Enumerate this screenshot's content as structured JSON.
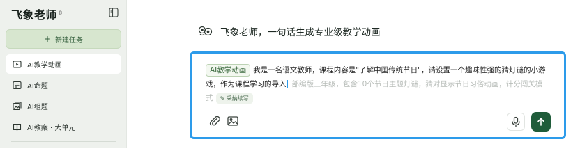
{
  "brand": {
    "name": "飞象老师",
    "mark": "®"
  },
  "sidebar": {
    "new_task_label": "新建任务",
    "items": [
      {
        "label": "AI教学动画",
        "icon": "animation-icon",
        "active": true
      },
      {
        "label": "AI命题",
        "icon": "list-icon",
        "active": false
      },
      {
        "label": "AI组题",
        "icon": "image-stack-icon",
        "active": false
      },
      {
        "label": "AI教案 · 大单元",
        "icon": "book-icon",
        "active": false
      }
    ]
  },
  "main": {
    "headline": "飞象老师，一句话生成专业级教学动画",
    "composer": {
      "chip": "AI教学动画",
      "typed_text": "我是一名语文教师，课程内容是\"了解中国传统节日\"，请设置一个趣味性强的猜灯谜的小游戏，作为课程学习的导入",
      "suggestion_text": "部编版三年级，包含10个节日主题灯谜，猜对显示节日习俗动画，计分闯关模式",
      "accept_label": "采纳续写"
    }
  },
  "colors": {
    "accent": "#2d9bea",
    "brand_green": "#1f5c3a",
    "sidebar_bg": "#eef1ed",
    "new_task_bg": "#d7e6cf"
  }
}
